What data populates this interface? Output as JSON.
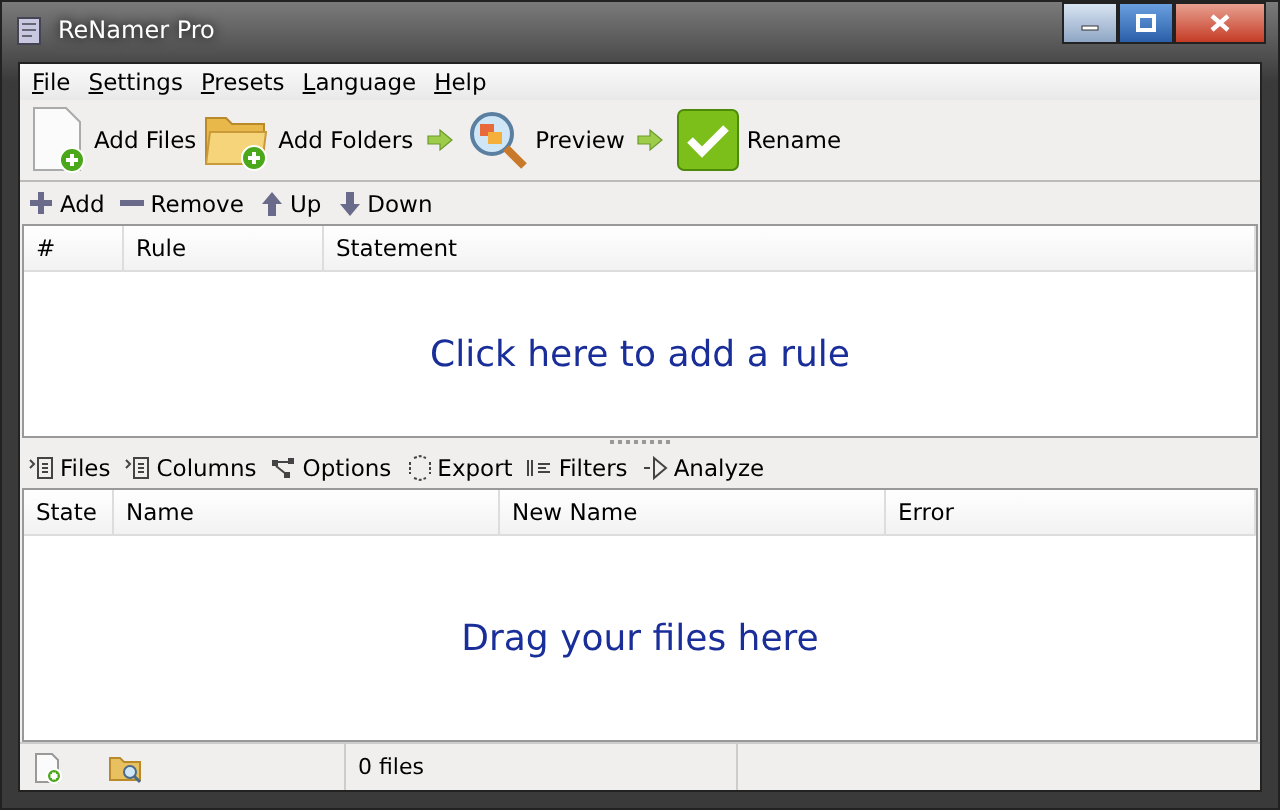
{
  "window": {
    "title": "ReNamer Pro"
  },
  "menu": [
    "File",
    "Settings",
    "Presets",
    "Language",
    "Help"
  ],
  "toolbar": [
    {
      "kind": "files",
      "label": "Add Files"
    },
    {
      "kind": "folders",
      "label": "Add Folders"
    },
    {
      "kind": "arrow"
    },
    {
      "kind": "preview",
      "label": "Preview"
    },
    {
      "kind": "arrow"
    },
    {
      "kind": "rename",
      "label": "Rename"
    }
  ],
  "rules_toolbar": [
    {
      "kind": "add",
      "label": "Add"
    },
    {
      "kind": "remove",
      "label": "Remove"
    },
    {
      "kind": "up",
      "label": "Up"
    },
    {
      "kind": "down",
      "label": "Down"
    }
  ],
  "rules_table": {
    "columns": [
      "#",
      "Rule",
      "Statement"
    ],
    "empty_text": "Click here to add a rule"
  },
  "files_toolbar": [
    {
      "kind": "files",
      "label": "Files"
    },
    {
      "kind": "columns",
      "label": "Columns"
    },
    {
      "kind": "options",
      "label": "Options"
    },
    {
      "kind": "export",
      "label": "Export"
    },
    {
      "kind": "filters",
      "label": "Filters"
    },
    {
      "kind": "analyze",
      "label": "Analyze"
    }
  ],
  "files_table": {
    "columns": [
      "State",
      "Name",
      "New Name",
      "Error"
    ],
    "empty_text": "Drag your files here"
  },
  "status_bar": {
    "count": "0 files"
  }
}
